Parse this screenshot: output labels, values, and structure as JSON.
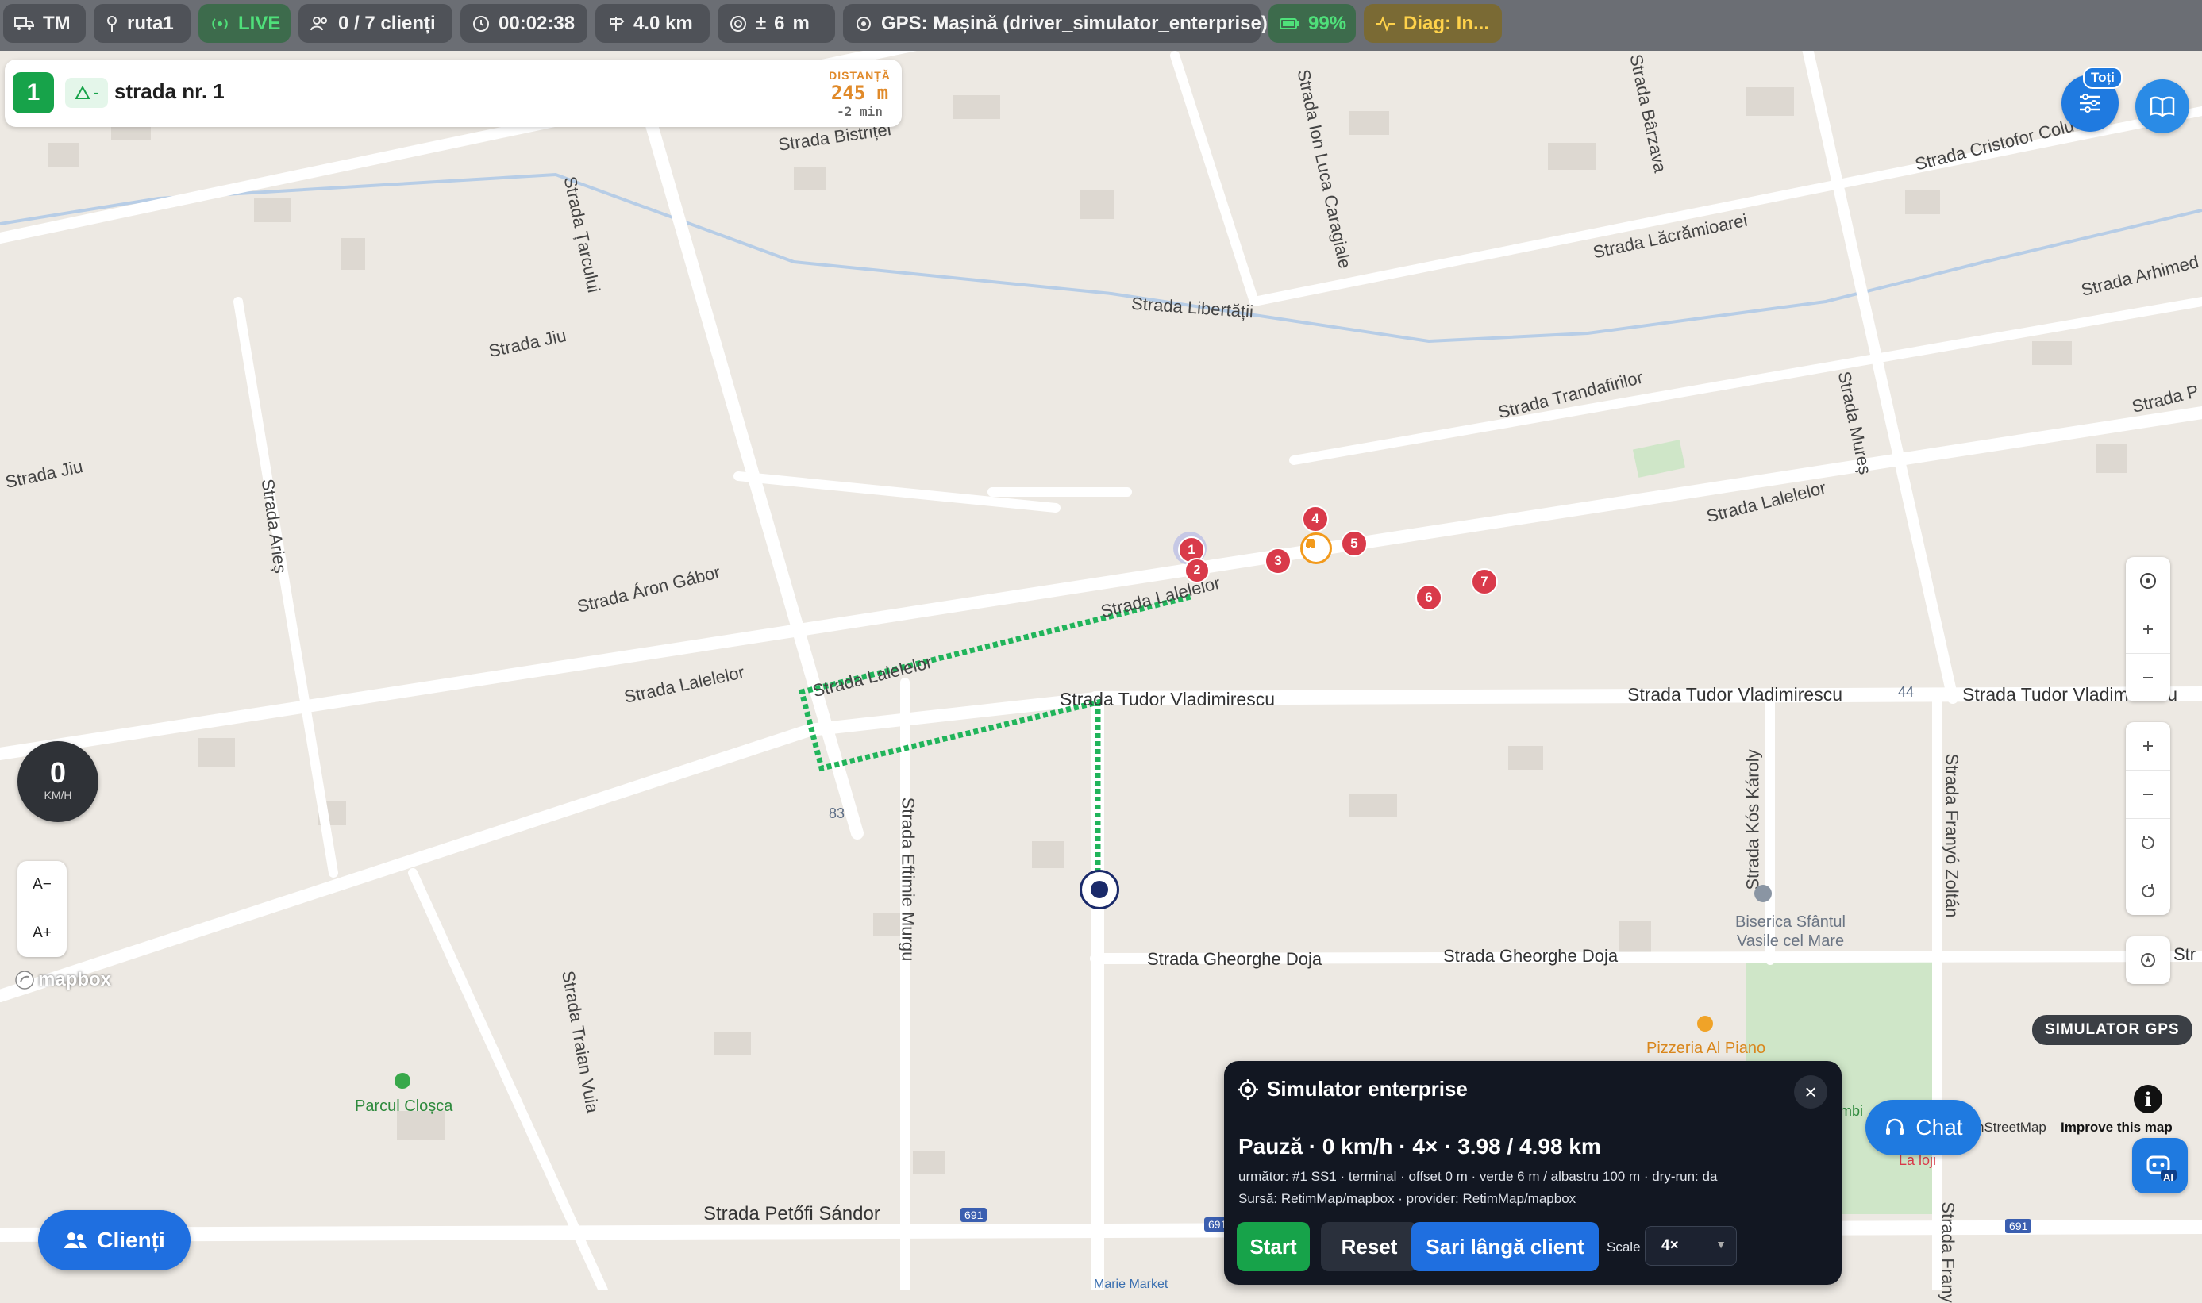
{
  "topbar": {
    "region": "TM",
    "route": "ruta1",
    "live": "LIVE",
    "clients": "0 / 7 clienți",
    "timer": "00:02:38",
    "distance": "4.0 km",
    "accuracy_prefix": "±",
    "accuracy_value": "6",
    "accuracy_unit": "m",
    "gps": "GPS: Mașină (driver_simulator_enterprise)",
    "battery": "99%",
    "diag": "Diag: In..."
  },
  "route_card": {
    "step_number": "1",
    "turn_text": "-",
    "street": "strada nr. 1",
    "distance_label": "DISTANȚĂ",
    "distance_value": "245 m",
    "eta": "-2 min"
  },
  "map": {
    "streets": {
      "bistrita": "Strada Bistriței",
      "tarcului": "Strada Țarcului",
      "ion_luca": "Strada Ion Luca Caragiale",
      "barzava": "Strada Bârzava",
      "cristofor": "Strada Cristofor Colu",
      "lacramioarei": "Strada Lăcrămioarei",
      "arhimede": "Strada Arhimed",
      "libertatii": "Strada Libertății",
      "jiu_1": "Strada Jiu",
      "jiu_2": "Strada Jiu",
      "trandafirilor": "Strada Trandafirilor",
      "mures": "Strada Mureș",
      "p_right": "Strada P",
      "aries": "Strada Arieș",
      "aron_gabor": "Strada Áron Gábor",
      "lalelelor_1": "Strada Lalelelor",
      "lalelelor_2": "Strada Lalelelor",
      "lalelelor_3": "Strada Lalelelor",
      "lalelelor_4": "Strada Lalelelor",
      "tudor_1": "Strada Tudor Vladimirescu",
      "tudor_2": "Strada Tudor Vladimirescu",
      "tudor_3": "Strada Tudor Vladimirescu",
      "eftimie": "Strada Eftimie Murgu",
      "kos_karoly": "Strada Kós Károly",
      "franyo_1": "Strada Franyó Zoltán",
      "franyo_2": "Strada Frany",
      "gheorghe_doja_1": "Strada Gheorghe Doja",
      "gheorghe_doja_2": "Strada Gheorghe Doja",
      "str_right": "Str",
      "traian_vuia": "Strada Traian Vuia",
      "petofi": "Strada Petőfi Sándor"
    },
    "pois": {
      "biserica_1": "Biserica Sfântul",
      "biserica_2": "Vasile cel Mare",
      "pizzeria": "Pizzeria Al Piano",
      "parcul": "Parcul Cloșca",
      "la_loji": "La loji",
      "mbi": "mbi",
      "marie": "Marie Market"
    },
    "house_numbers": {
      "n83": "83",
      "n44": "44"
    },
    "road_shields": {
      "s1": "691",
      "s2": "691",
      "s3": "691"
    },
    "stops": [
      "1",
      "2",
      "3",
      "4",
      "5",
      "6",
      "7"
    ],
    "route_color": "#20b45a",
    "stop_color": "#d93a4a",
    "vehicle_color": "#f29a1c"
  },
  "controls": {
    "filter_badge": "Toți",
    "speed_value": "0",
    "speed_unit": "KM/H",
    "font_decrease": "A−",
    "font_increase": "A+",
    "mapbox_logo": "mapbox",
    "simulator_gps_badge": "SIMULATOR GPS",
    "info": "i",
    "attribution_text": "nStreetMap",
    "improve_map": "Improve this map",
    "chat": "Chat",
    "ai": "AI",
    "clients_button": "Clienți"
  },
  "simulator": {
    "title": "Simulator enterprise",
    "close": "×",
    "status": "Pauză · 0 km/h · 4× · 3.98 / 4.98 km",
    "next_line": "următor: #1 SS1 · terminal · offset 0 m · verde 6 m / albastru 100 m · dry-run: da",
    "source_line": "Sursă: RetimMap/mapbox · provider: RetimMap/mapbox",
    "start": "Start",
    "reset": "Reset",
    "jump": "Sari lângă client",
    "scale_label": "Scale",
    "scale_value": "4×"
  },
  "colors": {
    "accent": "#1f7ae0",
    "success": "#17a34a",
    "panel_bg": "#121722",
    "topbar_bg": "#6b6e74"
  }
}
